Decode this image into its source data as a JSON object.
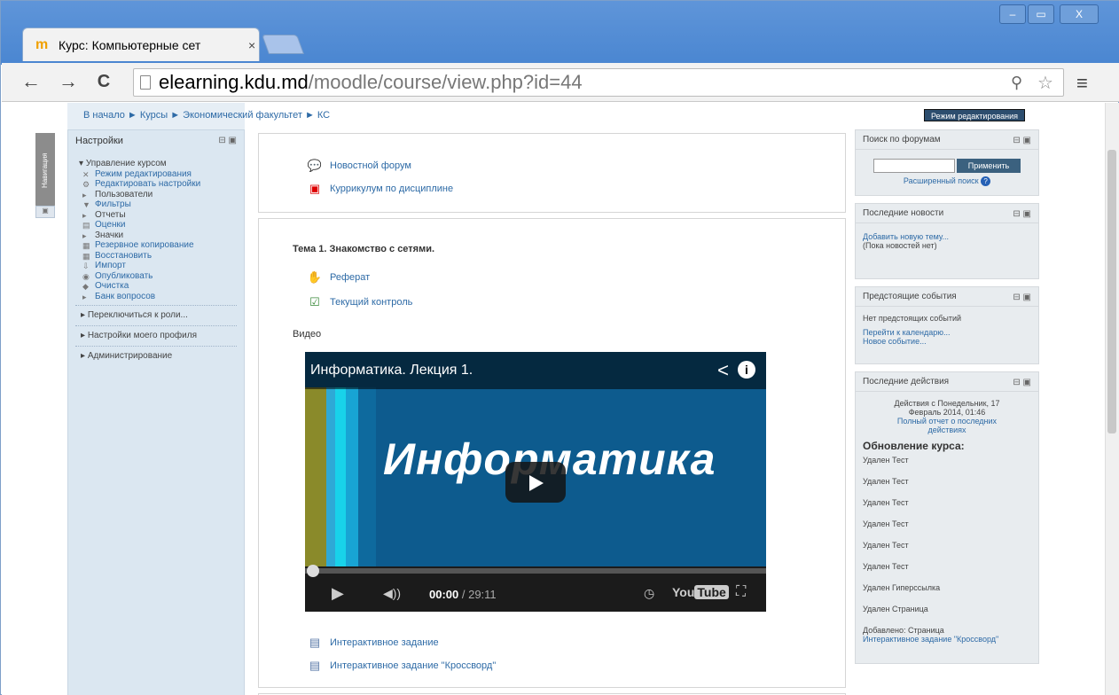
{
  "browser": {
    "tab_title": "Курс: Компьютерные сет",
    "tab_close": "×",
    "address_host": "elearning.kdu.md",
    "address_path": "/moodle/course/view.php?id=44",
    "back": "←",
    "forward": "→",
    "reload": "C",
    "win_min": "–",
    "win_max": "▭",
    "win_close": "X"
  },
  "breadcrumb": "В начало ► Курсы ► Экономический факультет ► КС",
  "edit_mode_button": "Режим редактирования",
  "nav_tab": "Навигация",
  "settings_block": {
    "title": "Настройки",
    "course_admin": "Управление курсом",
    "items": [
      {
        "label": "Режим редактирования",
        "link": true
      },
      {
        "label": "Редактировать настройки",
        "link": true
      },
      {
        "label": "Пользователи",
        "link": false
      },
      {
        "label": "Фильтры",
        "link": true
      },
      {
        "label": "Отчеты",
        "link": false
      },
      {
        "label": "Оценки",
        "link": true
      },
      {
        "label": "Значки",
        "link": false
      },
      {
        "label": "Резервное копирование",
        "link": true
      },
      {
        "label": "Восстановить",
        "link": true
      },
      {
        "label": "Импорт",
        "link": true
      },
      {
        "label": "Опубликовать",
        "link": true
      },
      {
        "label": "Очистка",
        "link": true
      },
      {
        "label": "Банк вопросов",
        "link": true
      }
    ],
    "switch_role": "Переключиться к роли...",
    "profile_settings": "Настройки моего профиля",
    "administration": "Администрирование"
  },
  "main": {
    "section0": {
      "news_forum": "Новостной форум",
      "curriculum": "Куррикулум по дисциплине"
    },
    "topic1": {
      "title": "Тема 1. Знакомство с сетями.",
      "essay": "Реферат",
      "control": "Текущий контроль",
      "video_label": "Видео",
      "video_title": "Информатика. Лекция 1.",
      "video_overlay": "Информатика",
      "time_current": "00:00",
      "time_total": "/ 29:11",
      "interactive1": "Интерактивное задание",
      "interactive2": "Интерактивное задание \"Кроссворд\""
    }
  },
  "right": {
    "forum_search": {
      "title": "Поиск по форумам",
      "apply": "Применить",
      "advanced": "Расширенный поиск"
    },
    "news": {
      "title": "Последние новости",
      "add": "Добавить новую тему...",
      "none": "(Пока новостей нет)"
    },
    "events": {
      "title": "Предстоящие события",
      "none": "Нет предстоящих событий",
      "calendar": "Перейти к календарю...",
      "new": "Новое событие..."
    },
    "activity": {
      "title": "Последние действия",
      "since": "Действия с Понедельник, 17 Февраль 2014, 01:46",
      "full_report": "Полный отчет о последних действиях",
      "updates_title": "Обновление курса:",
      "updates": [
        "Удален Тест",
        "Удален Тест",
        "Удален Тест",
        "Удален Тест",
        "Удален Тест",
        "Удален Тест",
        "Удален Гиперссылка",
        "Удален Страница",
        "Добавлено: Страница"
      ],
      "last_link": "Интерактивное задание \"Кроссворд\""
    }
  }
}
